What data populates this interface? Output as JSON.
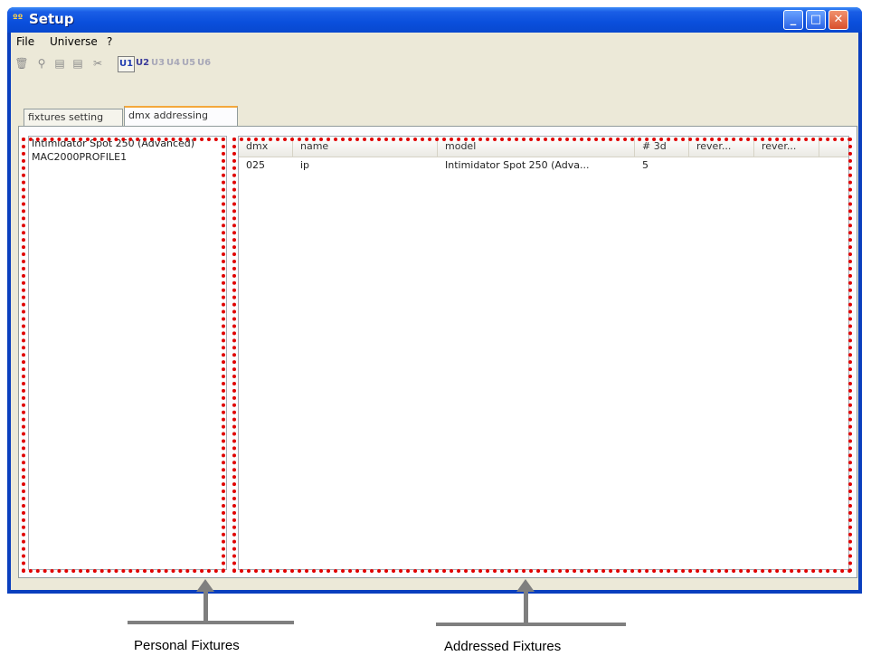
{
  "window": {
    "title": "Setup",
    "app_icon": "setup-app-icon"
  },
  "menu": {
    "items": [
      "File",
      "Universe",
      "?"
    ]
  },
  "toolbar": {
    "universes": [
      "U1",
      "U2",
      "U3",
      "U4",
      "U5",
      "U6"
    ],
    "active_universe": "U1"
  },
  "tabs": [
    "fixtures setting",
    "dmx addressing"
  ],
  "active_tab": "dmx addressing",
  "fixture_list": {
    "items": [
      "Intimidator Spot 250 (Advanced)",
      "MAC2000PROFILE1"
    ]
  },
  "grid": {
    "columns": [
      "dmx",
      "name",
      "model",
      "# 3d",
      "rever...",
      "rever..."
    ],
    "rows": [
      {
        "dmx": "025",
        "name": "ip",
        "model": "Intimidator Spot 250 (Adva...",
        "num3d": "5",
        "rev1": "",
        "rev2": ""
      }
    ]
  },
  "captions": {
    "left": "Personal Fixtures",
    "right": "Addressed Fixtures"
  },
  "highlight_color": "#e00000"
}
